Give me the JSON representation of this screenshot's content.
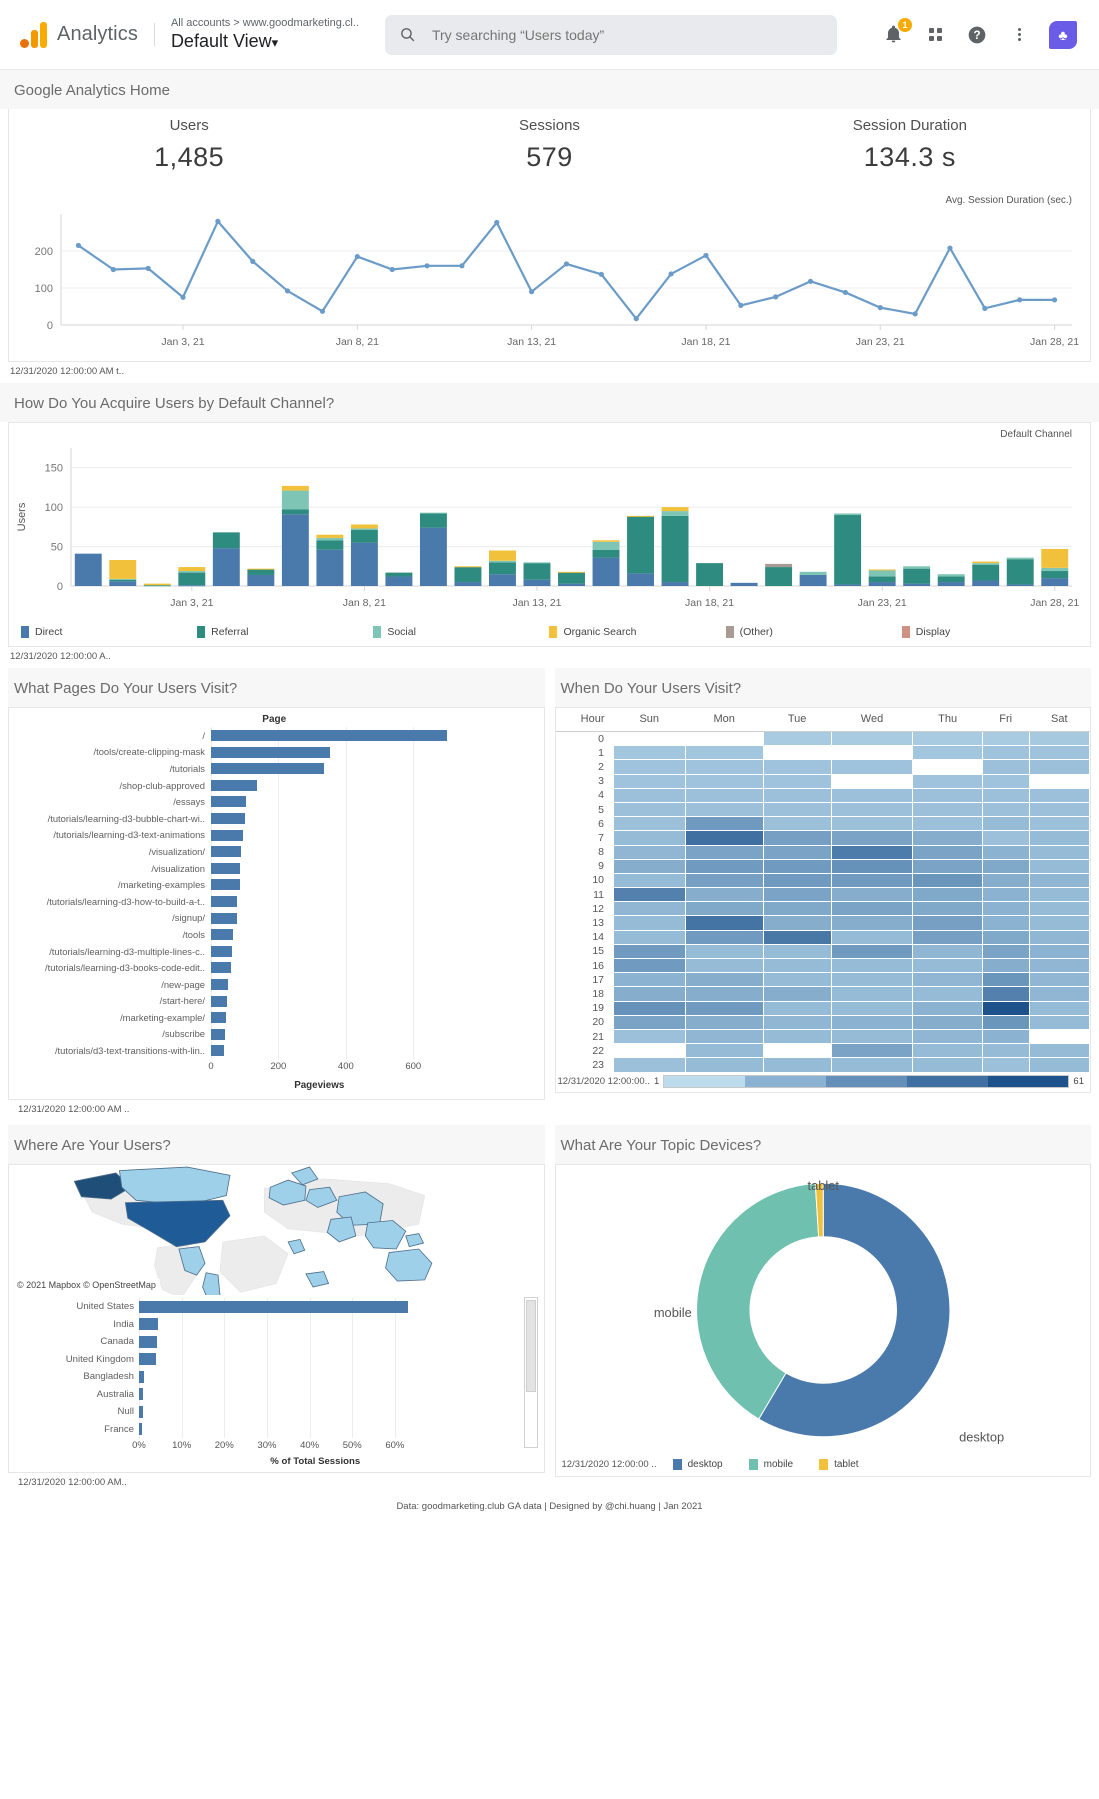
{
  "header": {
    "brand": "Analytics",
    "account_crumb": "All accounts > www.goodmarketing.cl..",
    "view_name": "Default View",
    "view_caret": "▾",
    "search_placeholder": "Try searching “Users today”",
    "search_value": "",
    "search_icon": "search-icon",
    "notifications_badge": "1",
    "icons": [
      "bell-icon",
      "apps-grid-icon",
      "help-icon",
      "kebab-menu-icon",
      "avatar"
    ],
    "avatar_glyph": "♣"
  },
  "dashboard": {
    "title": "Google Analytics Home",
    "credit": "Data: goodmarketing.club GA data | Designed by @chi.huang | Jan 2021"
  },
  "kpis": [
    {
      "label": "Users",
      "value": "1,485"
    },
    {
      "label": "Sessions",
      "value": "579"
    },
    {
      "label": "Session Duration",
      "value": "134.3 s"
    }
  ],
  "tiles": {
    "overview_footer": "12/31/2020 12:00:00 AM t..",
    "channel_footer": "12/31/2020 12:00:00 A..",
    "pages_footer": "12/31/2020 12:00:00 AM ..",
    "heatmap_footer": "12/31/2020 12:00:00..",
    "geo_footer": "12/31/2020 12:00:00 AM..",
    "devices_footer": "12/31/2020 12:00:00 .."
  },
  "sections": {
    "channel_title": "How Do You Acquire Users by Default Channel?",
    "pages_title": "What Pages Do Your Users Visit?",
    "hours_title": "When Do Your Users Visit?",
    "geo_title": "Where Are Your Users?",
    "devices_title": "What Are Your Topic Devices?"
  },
  "map": {
    "attribution": "© 2021 Mapbox © OpenStreetMap"
  },
  "colors": {
    "direct": "#4a7aab",
    "referral": "#2e8b7f",
    "social": "#7fc5b5",
    "organic": "#f2c13c",
    "other": "#a79c94",
    "display": "#cf9285",
    "line": "#6b9bc7",
    "bar": "#4a7aab",
    "heat_min": "#bcdcee",
    "heat_max": "#2e6da4"
  },
  "chart_data": [
    {
      "type": "line",
      "title": "",
      "annotation": "Avg. Session Duration (sec.)",
      "xlabel": "",
      "ylabel": "",
      "ylim": [
        0,
        300
      ],
      "yticks": [
        0,
        100,
        200
      ],
      "grid": true,
      "xtick_labels": [
        "Jan 3, 21",
        "Jan 8, 21",
        "Jan 13, 21",
        "Jan 18, 21",
        "Jan 23, 21",
        "Jan 28, 21"
      ],
      "x": [
        "Dec 31",
        "Jan 1",
        "Jan 2",
        "Jan 3",
        "Jan 4",
        "Jan 5",
        "Jan 6",
        "Jan 7",
        "Jan 8",
        "Jan 9",
        "Jan 10",
        "Jan 11",
        "Jan 12",
        "Jan 13",
        "Jan 14",
        "Jan 15",
        "Jan 16",
        "Jan 17",
        "Jan 18",
        "Jan 19",
        "Jan 20",
        "Jan 21",
        "Jan 22",
        "Jan 23",
        "Jan 24",
        "Jan 25",
        "Jan 26",
        "Jan 27",
        "Jan 28"
      ],
      "values": [
        215,
        150,
        153,
        75,
        280,
        172,
        92,
        37,
        185,
        150,
        160,
        160,
        277,
        90,
        165,
        137,
        17,
        138,
        188,
        53,
        76,
        118,
        88,
        47,
        30,
        208,
        45,
        68,
        68
      ]
    },
    {
      "type": "bar",
      "stacked": true,
      "title": "",
      "annotation": "Default Channel",
      "ylabel": "Users",
      "ylim": [
        0,
        175
      ],
      "yticks": [
        0,
        50,
        100,
        150
      ],
      "grid": true,
      "xtick_labels": [
        "Jan 3, 21",
        "Jan 8, 21",
        "Jan 13, 21",
        "Jan 18, 21",
        "Jan 23, 21",
        "Jan 28, 21"
      ],
      "categories": [
        "Dec 31",
        "Jan 1",
        "Jan 2",
        "Jan 3",
        "Jan 4",
        "Jan 5",
        "Jan 6",
        "Jan 7",
        "Jan 8",
        "Jan 9",
        "Jan 10",
        "Jan 11",
        "Jan 12",
        "Jan 13",
        "Jan 14",
        "Jan 15",
        "Jan 16",
        "Jan 17",
        "Jan 18",
        "Jan 19",
        "Jan 20",
        "Jan 21",
        "Jan 22",
        "Jan 23",
        "Jan 24",
        "Jan 25",
        "Jan 26",
        "Jan 27",
        "Jan 28"
      ],
      "series": [
        {
          "name": "Direct",
          "color": "#4a7aab",
          "values": [
            41,
            6,
            0,
            1,
            48,
            14,
            91,
            46,
            55,
            12,
            74,
            5,
            15,
            8,
            3,
            36,
            16,
            5,
            0,
            4,
            0,
            14,
            2,
            5,
            3,
            5,
            7,
            2,
            10
          ]
        },
        {
          "name": "Referral",
          "color": "#2e8b7f",
          "values": [
            0,
            2,
            1,
            16,
            20,
            7,
            6,
            12,
            16,
            5,
            18,
            19,
            15,
            21,
            14,
            10,
            72,
            84,
            29,
            0,
            24,
            0,
            88,
            7,
            19,
            7,
            20,
            32,
            9
          ]
        },
        {
          "name": "Social",
          "color": "#7fc5b5",
          "values": [
            0,
            1,
            0,
            2,
            0,
            0,
            24,
            3,
            2,
            0,
            1,
            0,
            2,
            1,
            0,
            10,
            0,
            6,
            0,
            0,
            0,
            4,
            2,
            8,
            3,
            3,
            2,
            2,
            4
          ]
        },
        {
          "name": "Organic Search",
          "color": "#f2c13c",
          "values": [
            0,
            24,
            2,
            5,
            0,
            1,
            6,
            4,
            5,
            0,
            0,
            1,
            13,
            0,
            1,
            2,
            1,
            5,
            0,
            0,
            0,
            0,
            0,
            1,
            0,
            0,
            2,
            0,
            24
          ]
        },
        {
          "name": "(Other)",
          "color": "#a79c94",
          "values": [
            0,
            0,
            0,
            0,
            0,
            0,
            0,
            0,
            0,
            0,
            0,
            0,
            0,
            0,
            0,
            0,
            0,
            0,
            0,
            0,
            4,
            0,
            0,
            0,
            0,
            0,
            0,
            0,
            0
          ]
        },
        {
          "name": "Display",
          "color": "#cf9285",
          "values": [
            0,
            0,
            0,
            0,
            0,
            0,
            0,
            0,
            0,
            0,
            0,
            0,
            0,
            0,
            0,
            0,
            0,
            0,
            0,
            0,
            0,
            0,
            0,
            0,
            0,
            0,
            0,
            0,
            0
          ]
        }
      ]
    },
    {
      "type": "bar",
      "orientation": "horizontal",
      "header": "Page",
      "xlabel": "Pageviews",
      "xlim": [
        0,
        700
      ],
      "xticks": [
        0,
        200,
        400,
        600
      ],
      "categories": [
        "/",
        "/tools/create-clipping-mask",
        "/tutorials",
        "/shop-club-approved",
        "/essays",
        "/tutorials/learning-d3-bubble-chart-wi..",
        "/tutorials/learning-d3-text-animations",
        "/visualization/",
        "/visualization",
        "/marketing-examples",
        "/tutorials/learning-d3-how-to-build-a-t..",
        "/signup/",
        "/tools",
        "/tutorials/learning-d3-multiple-lines-c..",
        "/tutorials/learning-d3-books-code-edit..",
        "/new-page",
        "/start-here/",
        "/marketing-example/",
        "/subscribe",
        "/tutorials/d3-text-transitions-with-lin.."
      ],
      "values": [
        700,
        352,
        336,
        136,
        104,
        101,
        95,
        88,
        86,
        85,
        78,
        77,
        66,
        62,
        60,
        50,
        47,
        45,
        41,
        39
      ]
    },
    {
      "type": "heatmap",
      "title": "When Do Your Users Visit?",
      "row_header": "Hour",
      "columns": [
        "Sun",
        "Mon",
        "Tue",
        "Wed",
        "Thu",
        "Fri",
        "Sat"
      ],
      "rows": [
        "0",
        "1",
        "2",
        "3",
        "4",
        "5",
        "6",
        "7",
        "8",
        "9",
        "10",
        "11",
        "12",
        "13",
        "14",
        "15",
        "16",
        "17",
        "18",
        "19",
        "20",
        "21",
        "22",
        "23"
      ],
      "legend_min": "1",
      "legend_max": "61",
      "values": [
        [
          0,
          0,
          6,
          6,
          6,
          6,
          7
        ],
        [
          8,
          8,
          0,
          0,
          8,
          9,
          9
        ],
        [
          9,
          9,
          9,
          9,
          0,
          10,
          10
        ],
        [
          9,
          9,
          9,
          0,
          9,
          9,
          0
        ],
        [
          10,
          10,
          10,
          10,
          10,
          10,
          10
        ],
        [
          10,
          10,
          10,
          10,
          10,
          10,
          10
        ],
        [
          10,
          26,
          10,
          10,
          10,
          12,
          10
        ],
        [
          12,
          46,
          24,
          22,
          18,
          10,
          12
        ],
        [
          14,
          22,
          22,
          40,
          22,
          16,
          12
        ],
        [
          18,
          26,
          26,
          30,
          22,
          20,
          12
        ],
        [
          12,
          24,
          26,
          26,
          28,
          18,
          14
        ],
        [
          38,
          18,
          22,
          18,
          20,
          16,
          12
        ],
        [
          14,
          20,
          20,
          22,
          20,
          16,
          12
        ],
        [
          12,
          44,
          18,
          18,
          24,
          16,
          12
        ],
        [
          12,
          26,
          42,
          12,
          24,
          20,
          14
        ],
        [
          26,
          12,
          12,
          26,
          14,
          22,
          16
        ],
        [
          26,
          12,
          12,
          12,
          12,
          18,
          14
        ],
        [
          16,
          18,
          12,
          12,
          14,
          28,
          14
        ],
        [
          18,
          18,
          18,
          12,
          12,
          38,
          14
        ],
        [
          30,
          26,
          12,
          12,
          16,
          61,
          12
        ],
        [
          22,
          18,
          14,
          16,
          18,
          28,
          12
        ],
        [
          10,
          14,
          12,
          12,
          14,
          16,
          0
        ],
        [
          0,
          12,
          0,
          22,
          12,
          12,
          12
        ],
        [
          10,
          12,
          12,
          12,
          12,
          10,
          12
        ]
      ]
    },
    {
      "type": "bar",
      "orientation": "horizontal",
      "title": "Where Are Your Users?",
      "xlabel": "% of Total Sessions",
      "xlim": [
        0,
        0.68
      ],
      "xticks": [
        "0%",
        "10%",
        "20%",
        "30%",
        "40%",
        "50%",
        "60%"
      ],
      "categories": [
        "United States",
        "India",
        "Canada",
        "United Kingdom",
        "Bangladesh",
        "Australia",
        "Null",
        "France"
      ],
      "values": [
        63.0,
        4.5,
        4.2,
        4.0,
        1.1,
        1.0,
        0.9,
        0.8
      ]
    },
    {
      "type": "pie",
      "donut": true,
      "title": "What Are Your Topic Devices?",
      "labels": [
        "desktop",
        "mobile",
        "tablet"
      ],
      "values": [
        58.5,
        40.5,
        1.0
      ],
      "colors": [
        "#4a7aab",
        "#6fc0ae",
        "#f2c13c"
      ],
      "annotations": [
        {
          "text": "tablet",
          "position": "top"
        },
        {
          "text": "mobile",
          "position": "left"
        },
        {
          "text": "desktop",
          "position": "bottom-right"
        }
      ],
      "legend": [
        "desktop",
        "mobile",
        "tablet"
      ]
    }
  ]
}
